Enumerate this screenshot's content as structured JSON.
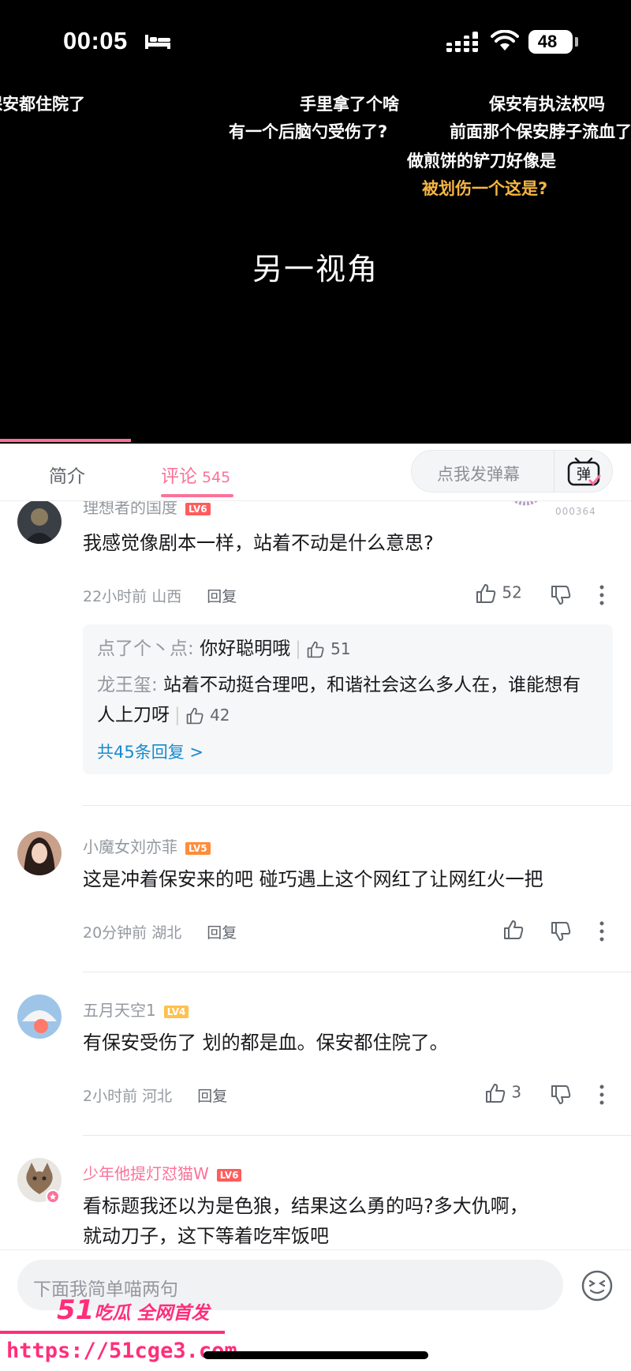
{
  "status_bar": {
    "time": "00:05",
    "battery": "48"
  },
  "video": {
    "title": "另一视角",
    "danmaku": [
      {
        "text": "保安都住院了",
        "color": "#ffffff"
      },
      {
        "text": "手里拿了个啥",
        "color": "#ffffff"
      },
      {
        "text": "保安有执法权吗",
        "color": "#ffffff"
      },
      {
        "text": "有一个后脑勺受伤了?",
        "color": "#ffffff"
      },
      {
        "text": "前面那个保安脖子流血了",
        "color": "#ffffff"
      },
      {
        "text": "做煎饼的铲刀好像是",
        "color": "#ffffff"
      },
      {
        "text": "被划伤一个这是?",
        "color": "#f5b642"
      }
    ]
  },
  "tabs": {
    "intro": "简介",
    "comments": "评论",
    "comments_count": "545",
    "danmaku_placeholder": "点我发弹幕",
    "danmaku_icon_text": "弹"
  },
  "comments": [
    {
      "user": "理想者的国度",
      "level": "LV6",
      "badge_number": "000364",
      "text": "我感觉像剧本一样，站着不动是什么意思?",
      "time": "22小时前",
      "location": "山西",
      "reply_label": "回复",
      "likes": "52",
      "replies": [
        {
          "user": "点了个丶点",
          "text": "你好聪明哦",
          "likes": "51"
        },
        {
          "user": "龙王玺",
          "text": "站着不动挺合理吧，和谐社会这么多人在，谁能想有人上刀呀",
          "likes": "42"
        }
      ],
      "more_replies": "共45条回复 >"
    },
    {
      "user": "小魔女刘亦菲",
      "level": "LV5",
      "text": "这是冲着保安来的吧 碰巧遇上这个网红了让网红火一把",
      "time": "20分钟前",
      "location": "湖北",
      "reply_label": "回复",
      "likes": ""
    },
    {
      "user": "五月天空1",
      "level": "LV4",
      "text": "有保安受伤了 划的都是血。保安都住院了。",
      "time": "2小时前",
      "location": "河北",
      "reply_label": "回复",
      "likes": "3"
    },
    {
      "user": "少年他提灯怼猫W",
      "level": "LV6",
      "text": "看标题我还以为是色狼，结果这么勇的吗?多大仇啊，就动刀子，这下等着吃牢饭吧"
    }
  ],
  "bottom": {
    "input_placeholder": "下面我简单喵两句",
    "watermark_brand": "51",
    "watermark_slogan": "吃瓜 全网首发",
    "watermark_url": "https://51cge3.com"
  },
  "colors": {
    "accent": "#fb7299",
    "link": "#178bcf",
    "watermark": "#ff2e7a"
  }
}
